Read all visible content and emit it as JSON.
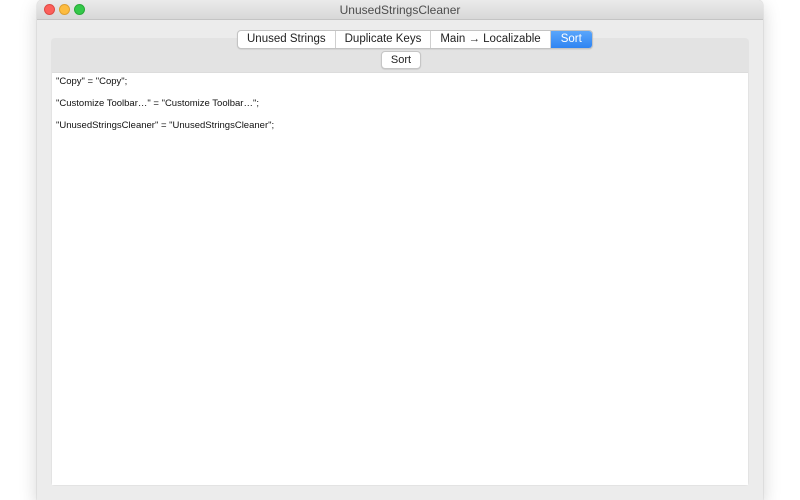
{
  "window": {
    "title": "UnusedStringsCleaner"
  },
  "tabs": [
    {
      "label": "Unused Strings",
      "selected": false
    },
    {
      "label": "Duplicate Keys",
      "selected": false
    },
    {
      "label": "Main → Localizable",
      "selected": false
    },
    {
      "label": "Sort",
      "selected": true
    }
  ],
  "toolbar": {
    "sort_label": "Sort"
  },
  "editor": {
    "lines": [
      "\"Copy\" = \"Copy\";",
      "\"Customize Toolbar…\" = \"Customize Toolbar…\";",
      "\"UnusedStringsCleaner\" = \"UnusedStringsCleaner\";"
    ]
  },
  "colors": {
    "accent": "#2f84f2",
    "close": "#fc605b",
    "minimize": "#fdbc40",
    "zoom": "#34c84a"
  }
}
